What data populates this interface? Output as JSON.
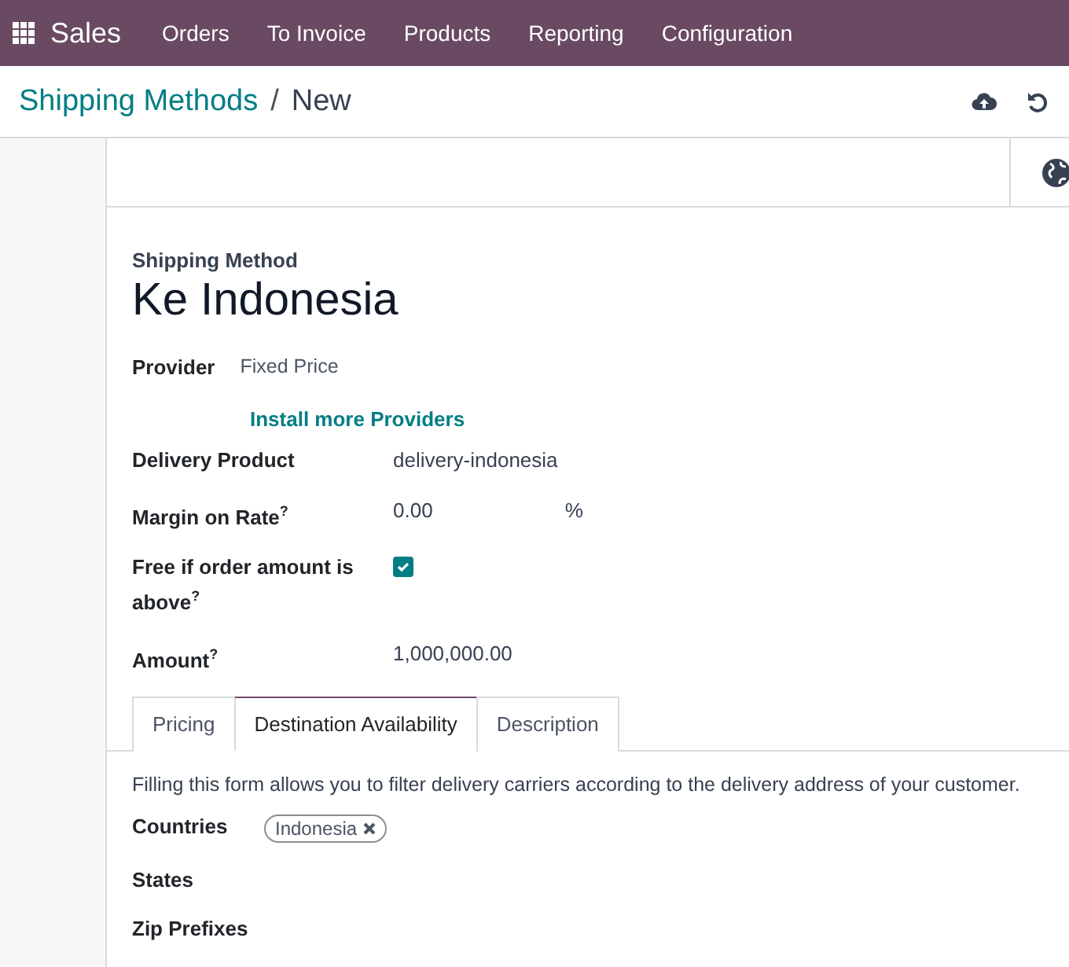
{
  "navbar": {
    "app_name": "Sales",
    "menu": [
      "Orders",
      "To Invoice",
      "Products",
      "Reporting",
      "Configuration"
    ]
  },
  "breadcrumb": {
    "parent": "Shipping Methods",
    "separator": "/",
    "current": "New"
  },
  "form": {
    "title_label": "Shipping Method",
    "name": "Ke Indonesia",
    "provider": {
      "label": "Provider",
      "value": "Fixed Price"
    },
    "install_link": "Install more Providers",
    "fields": [
      {
        "kind": "text",
        "label": "Delivery Product",
        "value": "delivery-indonesia"
      },
      {
        "kind": "text",
        "label": "Margin on Rate$^{?}$",
        "value": "0.00",
        "suffix": "%"
      },
      {
        "kind": "checkbox",
        "label": "Free if order amount is above$^{?}$",
        "checked": true
      },
      {
        "kind": "text",
        "label": "Amount$^{?}$",
        "value": "1,000,000.00"
      }
    ]
  },
  "tabs": [
    {
      "label": "Pricing",
      "selected": false
    },
    {
      "label": "Destination Availability",
      "selected": true
    },
    {
      "label": "Description",
      "selected": false
    }
  ],
  "tab_content": {
    "description": "Filling this form allows you to filter delivery carriers according to the delivery address of your customer.",
    "fields": [
      {
        "label": "Countries",
        "tags": [
          "Indonesia"
        ]
      },
      {
        "label": "States"
      },
      {
        "label": "Zip Prefixes"
      }
    ]
  }
}
